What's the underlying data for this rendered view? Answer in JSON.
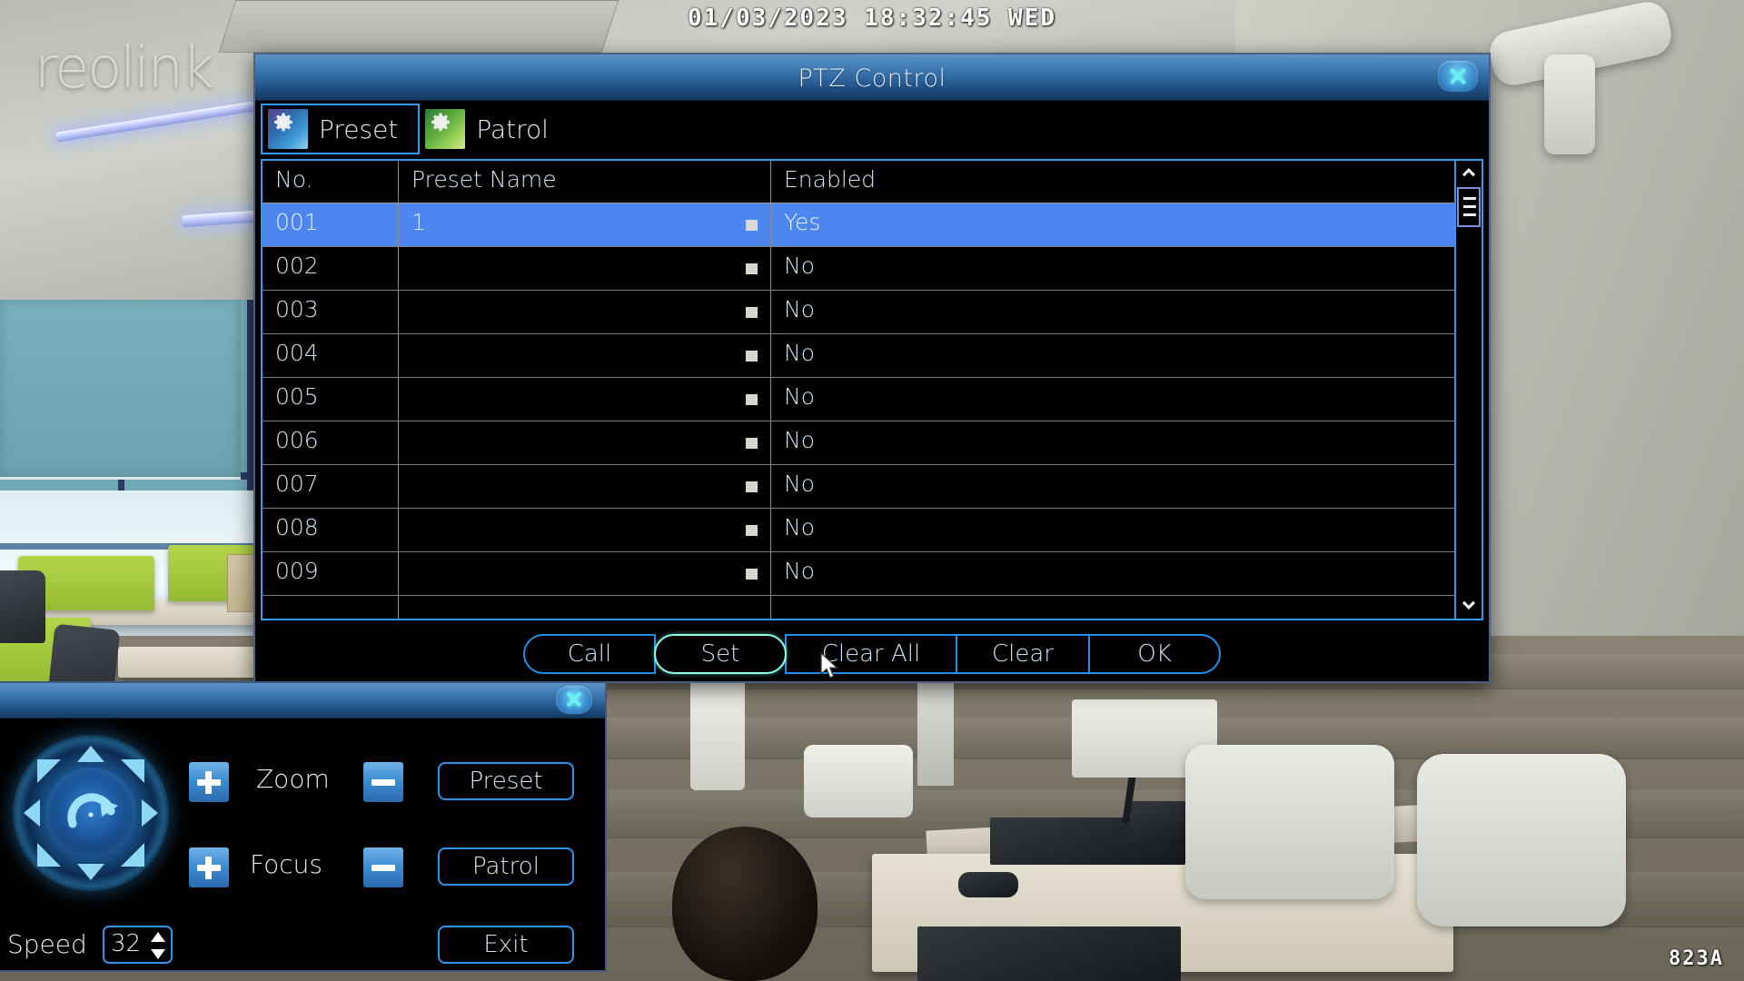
{
  "osd": {
    "datetime": "01/03/2023  18:32:45  WED",
    "channel": "823A",
    "watermark": "reolink"
  },
  "ptz_dialog": {
    "title": "PTZ Control",
    "close_icon": "close-icon",
    "tabs": [
      {
        "label": "Preset",
        "icon": "gear-arrow-icon",
        "active": true
      },
      {
        "label": "Patrol",
        "icon": "gear-arrow-icon",
        "active": false
      }
    ],
    "table": {
      "columns": [
        "No.",
        "Preset Name",
        "Enabled"
      ],
      "rows": [
        {
          "no": "001",
          "name": "1",
          "enabled": "Yes",
          "selected": true
        },
        {
          "no": "002",
          "name": "",
          "enabled": "No",
          "selected": false
        },
        {
          "no": "003",
          "name": "",
          "enabled": "No",
          "selected": false
        },
        {
          "no": "004",
          "name": "",
          "enabled": "No",
          "selected": false
        },
        {
          "no": "005",
          "name": "",
          "enabled": "No",
          "selected": false
        },
        {
          "no": "006",
          "name": "",
          "enabled": "No",
          "selected": false
        },
        {
          "no": "007",
          "name": "",
          "enabled": "No",
          "selected": false
        },
        {
          "no": "008",
          "name": "",
          "enabled": "No",
          "selected": false
        },
        {
          "no": "009",
          "name": "",
          "enabled": "No",
          "selected": false
        }
      ],
      "scrollbar": {
        "up_icon": "chevron-up-icon",
        "down_icon": "chevron-down-icon",
        "thumb_icon": "scroll-thumb-grip"
      }
    },
    "buttons": [
      {
        "label": "Call",
        "hover": false
      },
      {
        "label": "Set",
        "hover": true
      },
      {
        "label": "Clear All",
        "hover": false
      },
      {
        "label": "Clear",
        "hover": false
      },
      {
        "label": "OK",
        "hover": false
      }
    ]
  },
  "ptz_panel": {
    "close_icon": "close-icon",
    "joystick_icon": "ptz-directional-pad",
    "zoom_label": "Zoom",
    "focus_label": "Focus",
    "plus_icon": "plus-icon",
    "minus_icon": "minus-icon",
    "preset_button": "Preset",
    "patrol_button": "Patrol",
    "exit_button": "Exit",
    "speed_label": "Speed",
    "speed_value": "32",
    "spin_up_icon": "caret-up-icon",
    "spin_down_icon": "caret-down-icon"
  },
  "colors": {
    "accent_blue": "#2f9bf0",
    "selection_blue": "#4d86ee",
    "hover_cyan": "#8ffce6",
    "title_gradient_top": "#5d93c4",
    "title_gradient_bottom": "#15395f"
  }
}
